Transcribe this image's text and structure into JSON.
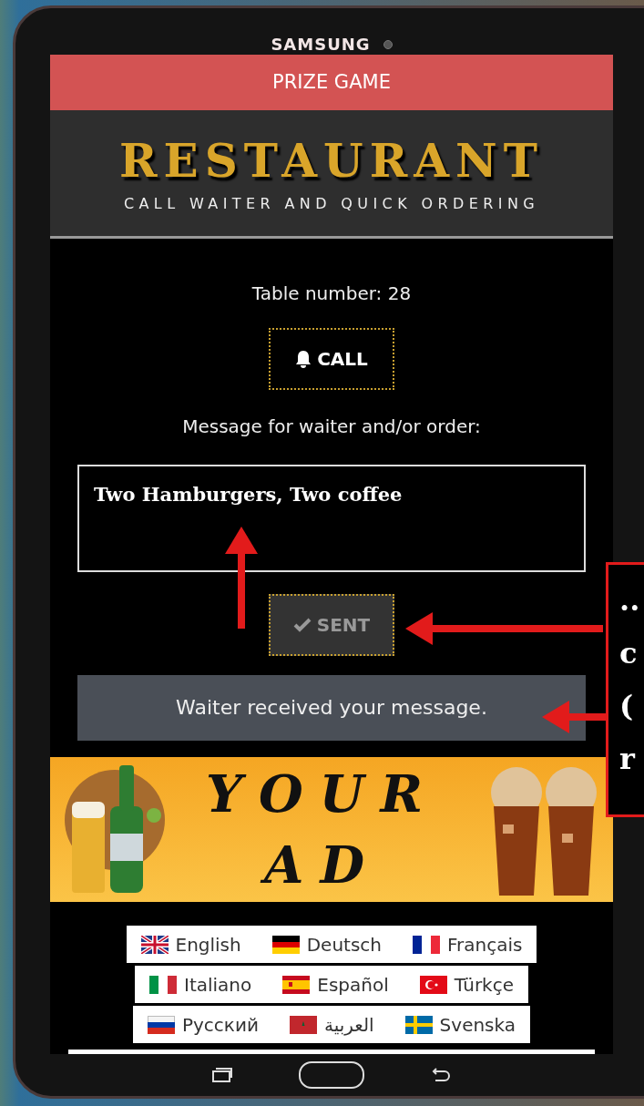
{
  "device": {
    "brand": "SAMSUNG"
  },
  "promo_bar": {
    "label": "PRIZE GAME"
  },
  "header": {
    "title": "RESTAURANT",
    "subtitle": "CALL WAITER AND QUICK ORDERING"
  },
  "table_number": "Table number: 28",
  "call_button": {
    "label": "CALL",
    "disabled": false
  },
  "message_label": "Message for waiter and/or order:",
  "message_field": {
    "value": "Two Hamburgers, Two coffee"
  },
  "sent_button": {
    "label": "SENT",
    "disabled": true
  },
  "status_message": "Waiter received your message.",
  "ad_banner": {
    "lines": [
      "YOUR",
      "AD"
    ]
  },
  "languages": [
    [
      {
        "label": "English",
        "kind": "uk"
      },
      {
        "label": "Deutsch",
        "kind": "de"
      },
      {
        "label": "Français",
        "kind": "fr"
      }
    ],
    [
      {
        "label": "Italiano",
        "kind": "it"
      },
      {
        "label": "Español",
        "kind": "es"
      },
      {
        "label": "Türkçe",
        "kind": "tr"
      }
    ],
    [
      {
        "label": "Русский",
        "kind": "ru"
      },
      {
        "label": "العربية",
        "kind": "ma"
      },
      {
        "label": "Svenska",
        "kind": "se"
      }
    ]
  ],
  "callout": {
    "lines": [
      "..",
      "c",
      "(",
      "r"
    ]
  }
}
